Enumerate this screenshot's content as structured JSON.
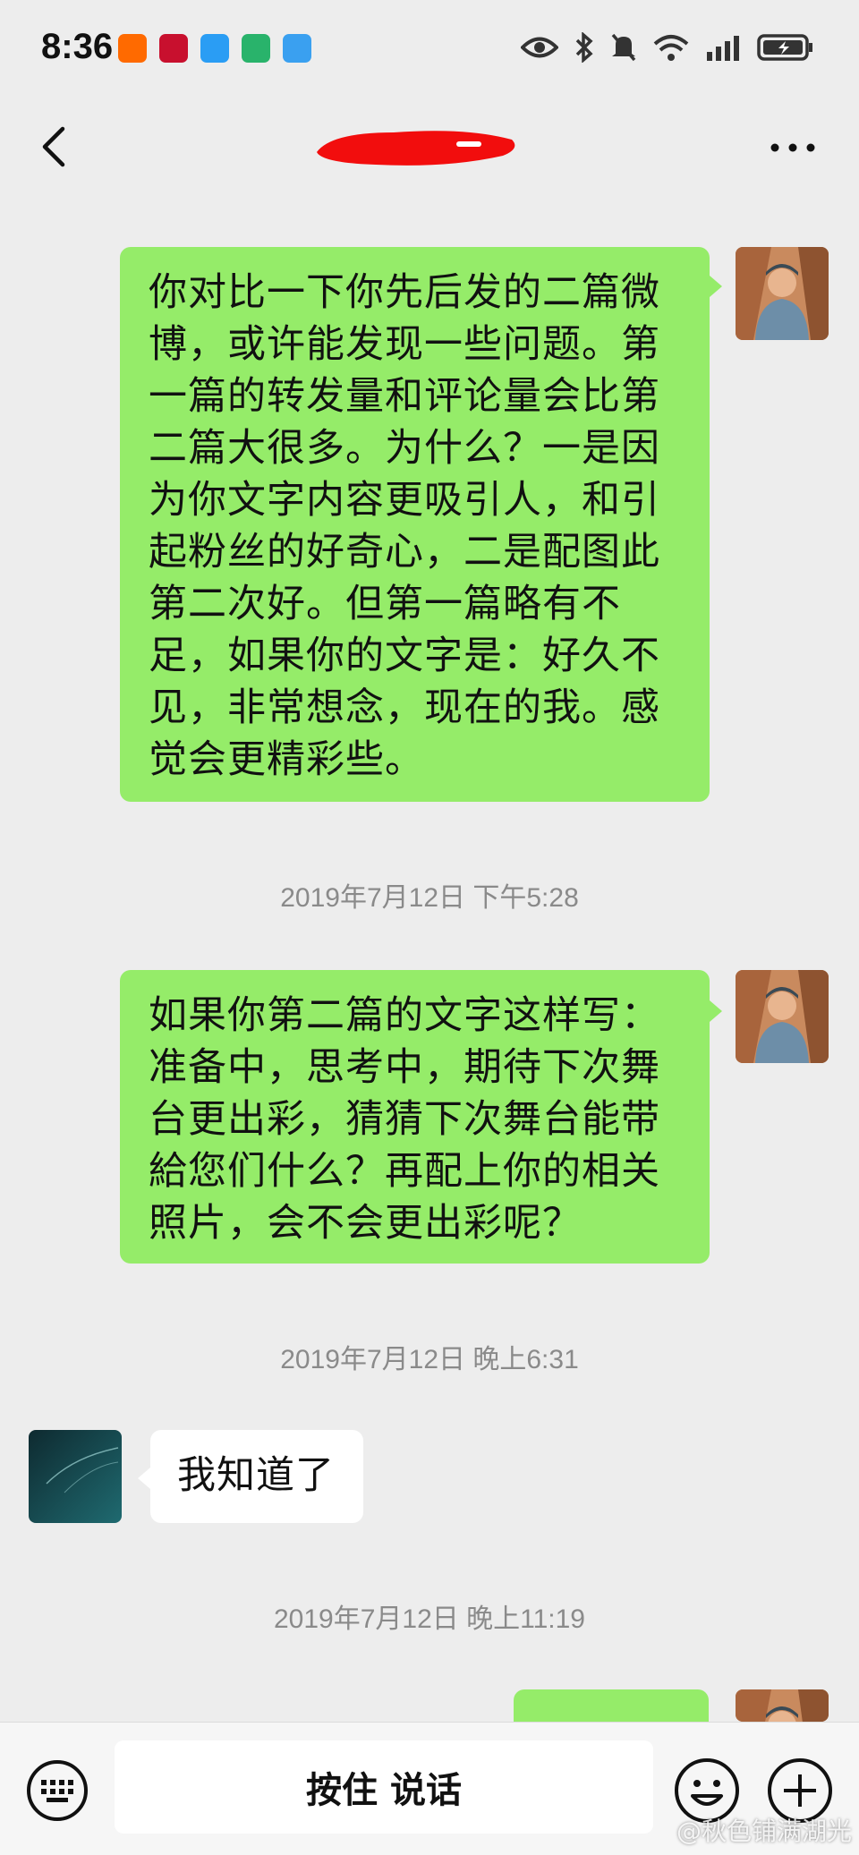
{
  "status_bar": {
    "time": "8:36",
    "notification_icons": [
      "taobao-icon",
      "bank-icon",
      "message-icon",
      "wallet-icon",
      "cloud-icon"
    ],
    "system_icons": [
      "eye-icon",
      "bluetooth-icon",
      "mute-icon",
      "wifi-icon",
      "signal-icon",
      "battery-icon"
    ]
  },
  "header": {
    "title": "",
    "title_redacted": true
  },
  "messages": [
    {
      "type": "outgoing",
      "text": "你对比一下你先后发的二篇微博，或许能发现一些问题。第一篇的转发量和评论量会比第二篇大很多。为什么？一是因为你文字内容更吸引人，和引起粉丝的好奇心，二是配图此第二次好。但第一篇略有不足，如果你的文字是：好久不见，非常想念，现在的我。感觉会更精彩些。"
    },
    {
      "type": "time",
      "text": "2019年7月12日 下午5:28"
    },
    {
      "type": "outgoing",
      "text": "如果你第二篇的文字这样写：准备中，思考中，期待下次舞台更出彩，猜猜下次舞台能带給您们什么？再配上你的相关照片，会不会更出彩呢？"
    },
    {
      "type": "time",
      "text": "2019年7月12日 晚上6:31"
    },
    {
      "type": "incoming",
      "text": "我知道了"
    },
    {
      "type": "time",
      "text": "2019年7月12日 晚上11:19"
    }
  ],
  "input_bar": {
    "hold_to_talk_label": "按住 说话"
  },
  "watermark": "@秋色铺满湖光",
  "colors": {
    "background": "#ededed",
    "outgoing_bubble": "#95ec69",
    "incoming_bubble": "#ffffff",
    "timestamp": "#8a8a8a"
  }
}
